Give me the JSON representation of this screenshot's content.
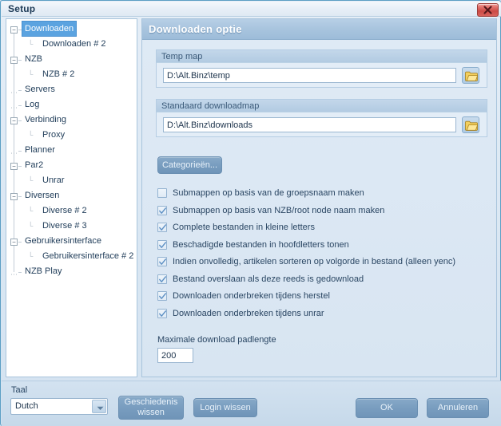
{
  "window": {
    "title": "Setup",
    "close_icon": "close-x-icon"
  },
  "tree": {
    "nodes": [
      {
        "label": "Downloaden",
        "depth": 0,
        "expander": "minus",
        "selected": true
      },
      {
        "label": "Downloaden # 2",
        "depth": 1,
        "expander": "leaf",
        "selected": false
      },
      {
        "label": "NZB",
        "depth": 0,
        "expander": "minus",
        "selected": false
      },
      {
        "label": "NZB # 2",
        "depth": 1,
        "expander": "leaf",
        "selected": false
      },
      {
        "label": "Servers",
        "depth": 0,
        "expander": "leaf",
        "selected": false
      },
      {
        "label": "Log",
        "depth": 0,
        "expander": "leaf",
        "selected": false
      },
      {
        "label": "Verbinding",
        "depth": 0,
        "expander": "minus",
        "selected": false
      },
      {
        "label": "Proxy",
        "depth": 1,
        "expander": "leaf",
        "selected": false
      },
      {
        "label": "Planner",
        "depth": 0,
        "expander": "leaf",
        "selected": false
      },
      {
        "label": "Par2",
        "depth": 0,
        "expander": "minus",
        "selected": false
      },
      {
        "label": "Unrar",
        "depth": 1,
        "expander": "leaf",
        "selected": false
      },
      {
        "label": "Diversen",
        "depth": 0,
        "expander": "minus",
        "selected": false
      },
      {
        "label": "Diverse # 2",
        "depth": 1,
        "expander": "leaf",
        "selected": false
      },
      {
        "label": "Diverse # 3",
        "depth": 1,
        "expander": "leaf",
        "selected": false
      },
      {
        "label": "Gebruikersinterface",
        "depth": 0,
        "expander": "minus",
        "selected": false
      },
      {
        "label": "Gebruikersinterface # 2",
        "depth": 1,
        "expander": "leaf",
        "selected": false
      },
      {
        "label": "NZB Play",
        "depth": 0,
        "expander": "leaf",
        "selected": false
      }
    ]
  },
  "main": {
    "header": "Downloaden optie",
    "groups": [
      {
        "title": "Temp map",
        "value": "D:\\Alt.Binz\\temp",
        "browse_icon": "folder-open-icon"
      },
      {
        "title": "Standaard downloadmap",
        "value": "D:\\Alt.Binz\\downloads",
        "browse_icon": "folder-open-icon"
      }
    ],
    "categories_button": "Categorieën...",
    "checkboxes": [
      {
        "label": "Submappen op basis van de groepsnaam maken",
        "checked": false
      },
      {
        "label": "Submappen op basis van NZB/root node naam maken",
        "checked": true
      },
      {
        "label": "Complete bestanden in kleine letters",
        "checked": true
      },
      {
        "label": "Beschadigde bestanden in hoofdletters tonen",
        "checked": true
      },
      {
        "label": "Indien onvolledig, artikelen sorteren op volgorde in bestand (alleen yenc)",
        "checked": true
      },
      {
        "label": "Bestand overslaan als deze reeds is gedownload",
        "checked": true
      },
      {
        "label": "Downloaden onderbreken tijdens herstel",
        "checked": true
      },
      {
        "label": "Downloaden onderbreken tijdens unrar",
        "checked": true
      }
    ],
    "path_length": {
      "label": "Maximale download padlengte",
      "value": "200"
    }
  },
  "bottom": {
    "language_label": "Taal",
    "language_value": "Dutch",
    "clear_history_button": "Geschiedenis wissen",
    "clear_login_button": "Login wissen",
    "ok_button": "OK",
    "cancel_button": "Annuleren"
  },
  "colors": {
    "accent": "#5ba3e0",
    "panel_header": "#a8c4de",
    "close_red": "#cc4a45",
    "button_blue": "#7a9ec0"
  }
}
